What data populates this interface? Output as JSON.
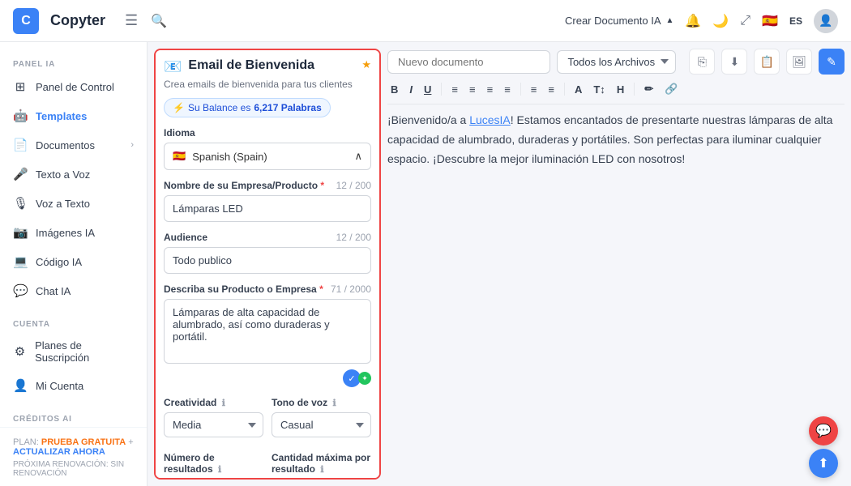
{
  "app": {
    "logo_letter": "C",
    "logo_name": "Copyter",
    "crear_btn_label": "Crear Documento IA",
    "lang_code": "ES",
    "flag_emoji": "🇪🇸"
  },
  "sidebar": {
    "panel_ia_label": "PANEL IA",
    "cuenta_label": "CUENTA",
    "creditos_label": "CRÉDITOS AI",
    "items_ia": [
      {
        "id": "panel-control",
        "label": "Panel de Control",
        "icon": "⊞"
      },
      {
        "id": "templates",
        "label": "Templates",
        "icon": "⊟",
        "active": true
      },
      {
        "id": "documentos",
        "label": "Documentos",
        "icon": "📄",
        "has_arrow": true
      },
      {
        "id": "texto-a-voz",
        "label": "Texto a Voz",
        "icon": "🎤"
      },
      {
        "id": "voz-a-texto",
        "label": "Voz a Texto",
        "icon": "🎙"
      },
      {
        "id": "imagenes-ia",
        "label": "Imágenes IA",
        "icon": "📷"
      },
      {
        "id": "codigo-ia",
        "label": "Código IA",
        "icon": "💻"
      },
      {
        "id": "chat-ia",
        "label": "Chat IA",
        "icon": "💬"
      }
    ],
    "items_cuenta": [
      {
        "id": "planes",
        "label": "Planes de Suscripción",
        "icon": "🔧"
      },
      {
        "id": "mi-cuenta",
        "label": "Mi Cuenta",
        "icon": "👤"
      }
    ],
    "plan_label": "PLAN:",
    "plan_name": "PRUEBA GRATUITA",
    "plan_upgrade": "ACTUALIZAR AHORA",
    "renovacion_label": "PRÓXIMA RENOVACIÓN: SIN RENOVACIÓN"
  },
  "form": {
    "icon": "📧",
    "title": "Email de Bienvenida",
    "subtitle": "Crea emails de bienvenida para tus clientes",
    "balance_label": "Su Balance es",
    "balance_value": "6,217 Palabras",
    "idioma_label": "Idioma",
    "selected_lang": "Spanish (Spain)",
    "lang_flag": "🇪🇸",
    "nombre_label": "Nombre de su Empresa/Producto",
    "nombre_req": "*",
    "nombre_count": "12 / 200",
    "nombre_value": "Lámparas LED",
    "audience_label": "Audience",
    "audience_count": "12 / 200",
    "audience_value": "Todo publico",
    "describe_label": "Describa su Producto o Empresa",
    "describe_req": "*",
    "describe_count": "71 / 2000",
    "describe_value": "Lámparas de alta capacidad de alumbrado, así como duraderas y portátil.",
    "creatividad_label": "Creatividad",
    "creatividad_value": "Media",
    "tono_label": "Tono de voz",
    "tono_value": "Casual",
    "num_resultados_label": "Número de resultados",
    "cantidad_label": "Cantidad máxima por resultado"
  },
  "editor": {
    "doc_name_placeholder": "Nuevo documento",
    "archive_select": "Todos los Archivos",
    "content": "¡Bienvenido/a a LucesIA! Estamos encantados de presentarte nuestras lámparas de alta capacidad de alumbrado, duraderas y portátiles. Son perfectas para iluminar cualquier espacio. ¡Descubre la mejor iluminación LED con nosotros!",
    "link_text": "LucesIA"
  },
  "format_toolbar": {
    "buttons": [
      "B",
      "I",
      "U",
      "≡",
      "≡",
      "≡",
      "≡",
      "≡",
      "≡",
      "A",
      "T↕",
      "H",
      "✏",
      "🔗"
    ]
  }
}
